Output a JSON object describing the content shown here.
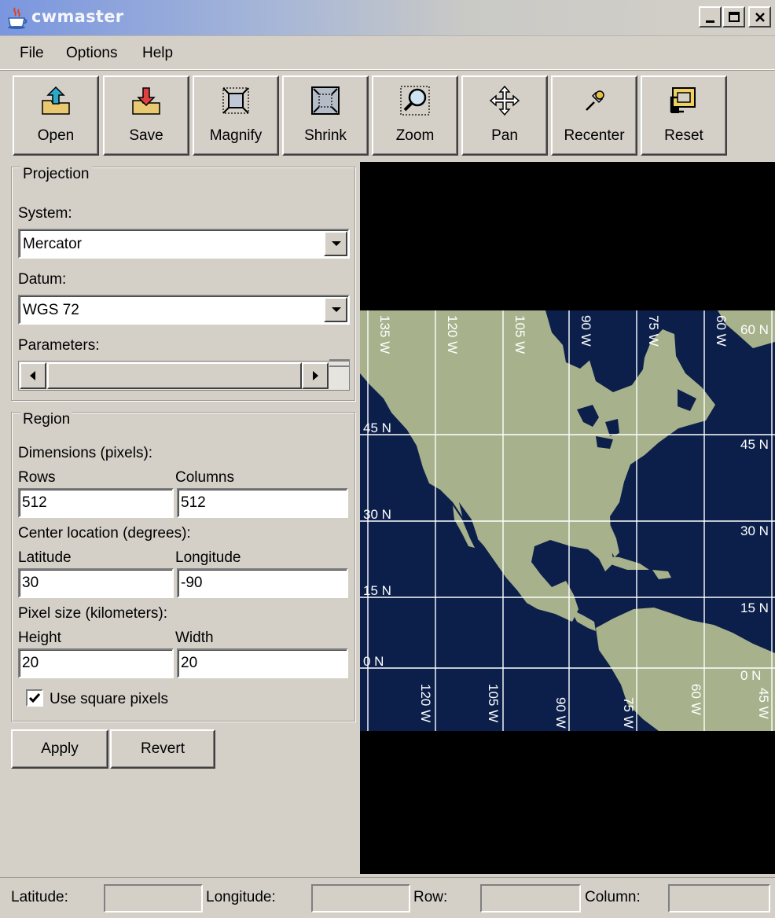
{
  "window": {
    "title": "cwmaster",
    "controls": [
      "minimize",
      "maximize",
      "close"
    ]
  },
  "menubar": {
    "items": [
      "File",
      "Options",
      "Help"
    ]
  },
  "toolbar": {
    "buttons": [
      {
        "label": "Open",
        "icon": "open-folder-icon"
      },
      {
        "label": "Save",
        "icon": "save-folder-icon"
      },
      {
        "label": "Magnify",
        "icon": "magnify-icon"
      },
      {
        "label": "Shrink",
        "icon": "shrink-icon"
      },
      {
        "label": "Zoom",
        "icon": "zoom-magnifier-icon"
      },
      {
        "label": "Pan",
        "icon": "pan-arrows-icon"
      },
      {
        "label": "Recenter",
        "icon": "recenter-pin-icon"
      },
      {
        "label": "Reset",
        "icon": "reset-icon"
      }
    ]
  },
  "projection": {
    "legend": "Projection",
    "system_label": "System:",
    "system_value": "Mercator",
    "datum_label": "Datum:",
    "datum_value": "WGS 72",
    "parameters_label": "Parameters:"
  },
  "region": {
    "legend": "Region",
    "dimensions_label": "Dimensions (pixels):",
    "rows_label": "Rows",
    "rows_value": "512",
    "columns_label": "Columns",
    "columns_value": "512",
    "center_label": "Center location (degrees):",
    "latitude_label": "Latitude",
    "latitude_value": "30",
    "longitude_label": "Longitude",
    "longitude_value": "-90",
    "pixel_size_label": "Pixel size (kilometers):",
    "height_label": "Height",
    "height_value": "20",
    "width_label": "Width",
    "width_value": "20",
    "square_pixels_label": "Use square pixels",
    "square_pixels_checked": true
  },
  "actions": {
    "apply_label": "Apply",
    "revert_label": "Revert"
  },
  "map": {
    "ocean_color": "#0c1f4b",
    "land_color": "#a7b28c",
    "lat_labels_left": [
      "45 N",
      "30 N",
      "15 N",
      "0 N"
    ],
    "lat_labels_right": [
      "60 N",
      "45 N",
      "30 N",
      "15 N",
      "0 N"
    ],
    "lon_labels_top": [
      "135 W",
      "120 W",
      "105 W",
      "90 W",
      "75 W",
      "60 W"
    ],
    "lon_labels_bottom": [
      "120 W",
      "105 W",
      "90 W",
      "75 W",
      "60 W",
      "45 W"
    ]
  },
  "statusbar": {
    "latitude_label": "Latitude:",
    "longitude_label": "Longitude:",
    "row_label": "Row:",
    "column_label": "Column:",
    "latitude_value": "",
    "longitude_value": "",
    "row_value": "",
    "column_value": ""
  }
}
